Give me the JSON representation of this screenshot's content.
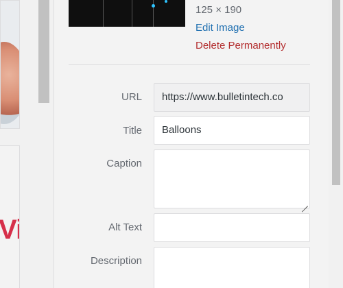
{
  "attachment": {
    "dimensions": "125 × 190",
    "edit_link": "Edit Image",
    "delete_link": "Delete Permanently"
  },
  "fields": {
    "url": {
      "label": "URL",
      "value": "https://www.bulletintech.co"
    },
    "title": {
      "label": "Title",
      "value": "Balloons"
    },
    "caption": {
      "label": "Caption",
      "value": ""
    },
    "alt_text": {
      "label": "Alt Text",
      "value": ""
    },
    "description": {
      "label": "Description",
      "value": ""
    }
  },
  "left_thumbnail_text": "Vi",
  "colors": {
    "link": "#2271b1",
    "delete": "#b32d2e",
    "label": "#646970",
    "brand_red": "#d62f4a"
  }
}
